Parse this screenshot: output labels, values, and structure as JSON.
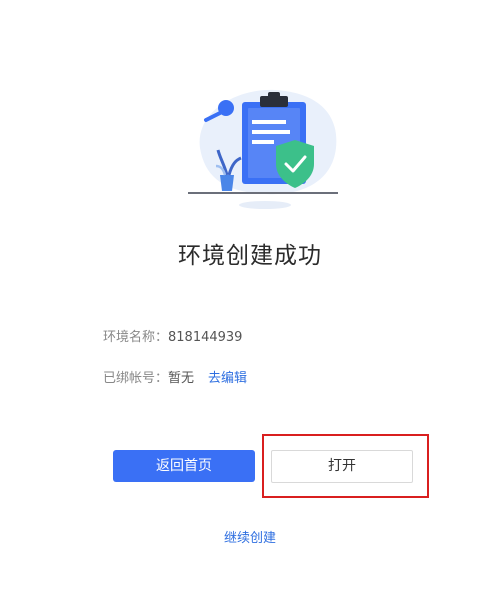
{
  "result": {
    "title": "环境创建成功"
  },
  "info": {
    "env_name_label": "环境名称：",
    "env_name_value": "818144939",
    "account_label": "已绑帐号：",
    "account_value": "暂无",
    "edit_link": "去编辑"
  },
  "actions": {
    "home_button": "返回首页",
    "open_button": "打开",
    "continue_link": "继续创建"
  },
  "colors": {
    "primary": "#3a70f5",
    "link": "#2f6fe0",
    "highlight": "#d91f1f",
    "shield": "#3cc08a"
  },
  "icons": [
    "clipboard-icon",
    "shield-check-icon",
    "plant-icon"
  ]
}
